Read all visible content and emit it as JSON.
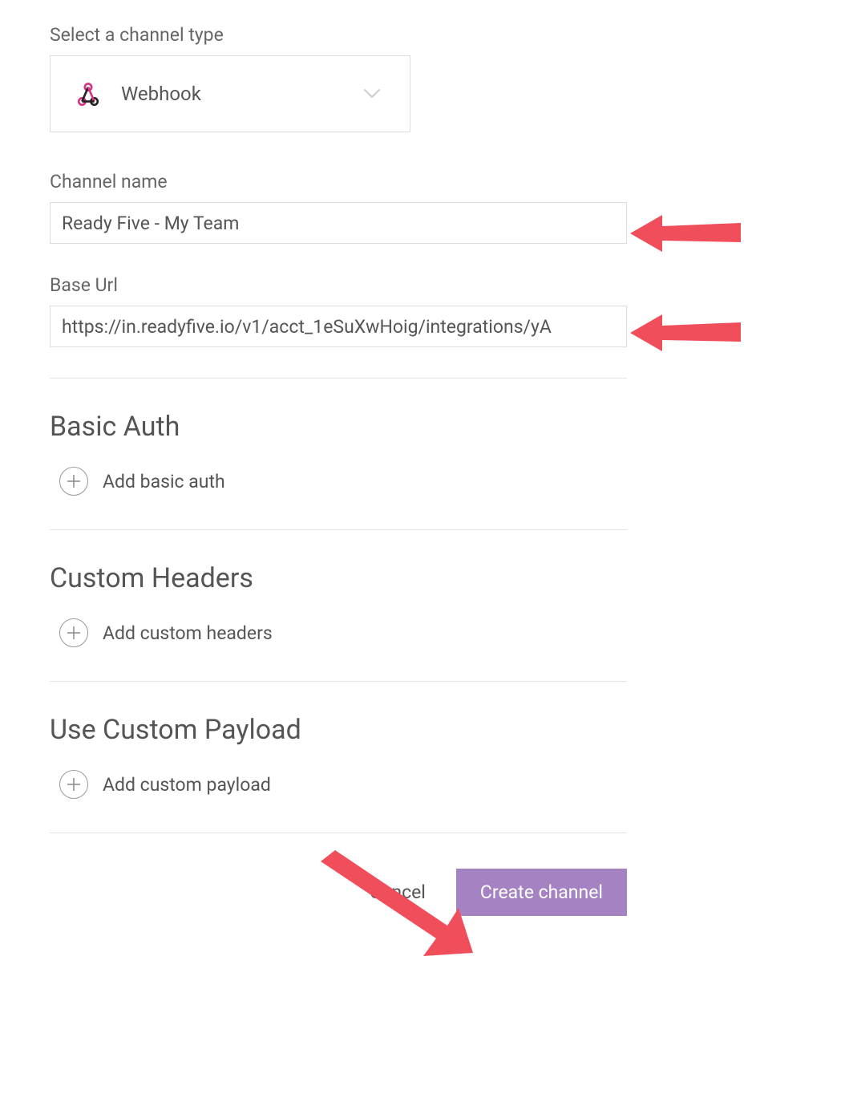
{
  "channelType": {
    "label": "Select a channel type",
    "selected": "Webhook"
  },
  "channelName": {
    "label": "Channel name",
    "value": "Ready Five - My Team"
  },
  "baseUrl": {
    "label": "Base Url",
    "value": "https://in.readyfive.io/v1/acct_1eSuXwHoig/integrations/yA"
  },
  "sections": {
    "basicAuth": {
      "heading": "Basic Auth",
      "addLabel": "Add basic auth"
    },
    "customHeaders": {
      "heading": "Custom Headers",
      "addLabel": "Add custom headers"
    },
    "customPayload": {
      "heading": "Use Custom Payload",
      "addLabel": "Add custom payload"
    }
  },
  "buttons": {
    "cancel": "Cancel",
    "create": "Create channel"
  },
  "colors": {
    "primary": "#a583c3",
    "arrow": "#f04e5a"
  }
}
